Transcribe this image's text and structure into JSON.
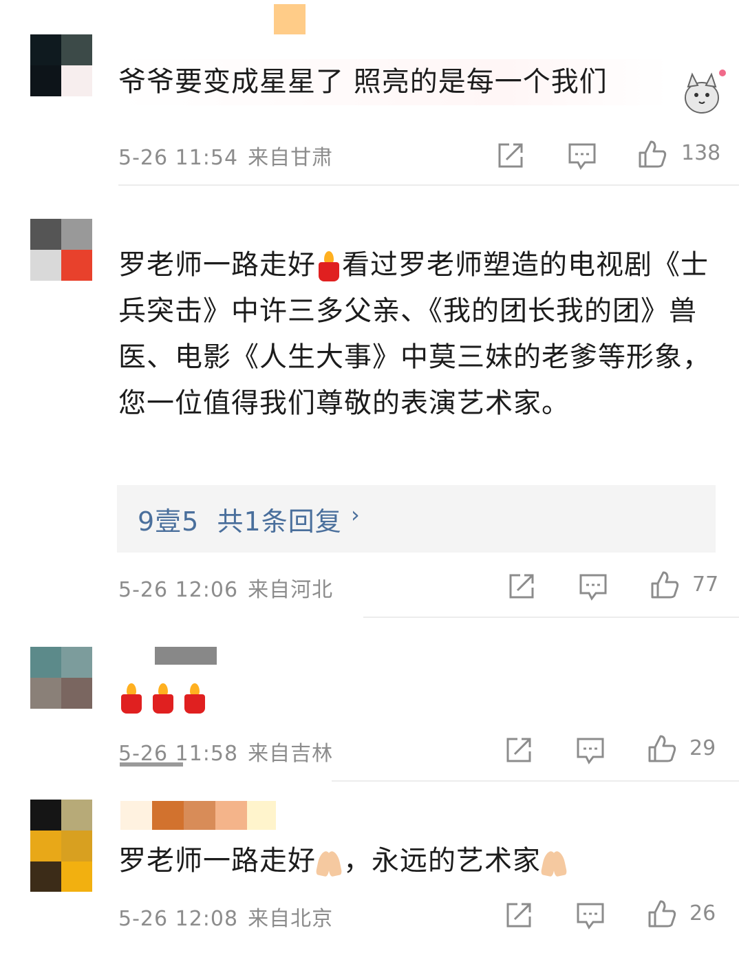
{
  "comments": [
    {
      "avatar": [
        "#0f1a1f",
        "#3c4a48",
        "#0d1419",
        "#f7eeee"
      ],
      "name_colors": [],
      "text": "爷爷要变成星星了 照亮的是每一个我们",
      "time": "5-26 11:54",
      "location": "来自甘肃",
      "likes": "138"
    },
    {
      "avatar": [
        "#555555",
        "#999999",
        "#d9d9d9",
        "#e8412c"
      ],
      "name_colors": [],
      "text_parts": [
        "罗老师一路走好",
        "看过罗老师塑造的电视剧《士兵突击》中许三多父亲、《我的团长我的团》兽医、电影《人生大事》中莫三妹的老爹等形象，您一位值得我们尊敬的表演艺术家。"
      ],
      "reply": {
        "user": "9壹5",
        "summary": "共1条回复",
        "arrow": "›"
      },
      "time": "5-26 12:06",
      "location": "来自河北",
      "likes": "77"
    },
    {
      "avatar": [
        "#5c8a8a",
        "#7c9c9c",
        "#8a8078",
        "#7a6660"
      ],
      "name_colors": [
        "#ffffff",
        "#888888"
      ],
      "text": "",
      "time": "5-26 11:58",
      "location": "来自吉林",
      "likes": "29"
    },
    {
      "avatar": [
        "#151515",
        "#b7aa78",
        "#e8a818",
        "#d8a020",
        "#3c2c18",
        "#f2b010"
      ],
      "name_colors": [
        "#fff2e0",
        "#d2722e",
        "#d88c58",
        "#f4b48a",
        "#fff4cc"
      ],
      "text_parts": [
        "罗老师一路走好",
        "，永远的艺术家"
      ],
      "time": "5-26 12:08",
      "location": "来自北京",
      "likes": "26"
    }
  ],
  "icons": {
    "share": "share-icon",
    "comment": "comment-icon",
    "like": "like-icon",
    "candle": "candle-emoji-icon",
    "pray": "pray-emoji-icon",
    "sticker": "cat-sticker-icon"
  },
  "colors": {
    "text": "#1c1c1c",
    "meta": "#8c8c8c",
    "link": "#4a6f9c",
    "reply_bg": "#f4f4f4"
  }
}
